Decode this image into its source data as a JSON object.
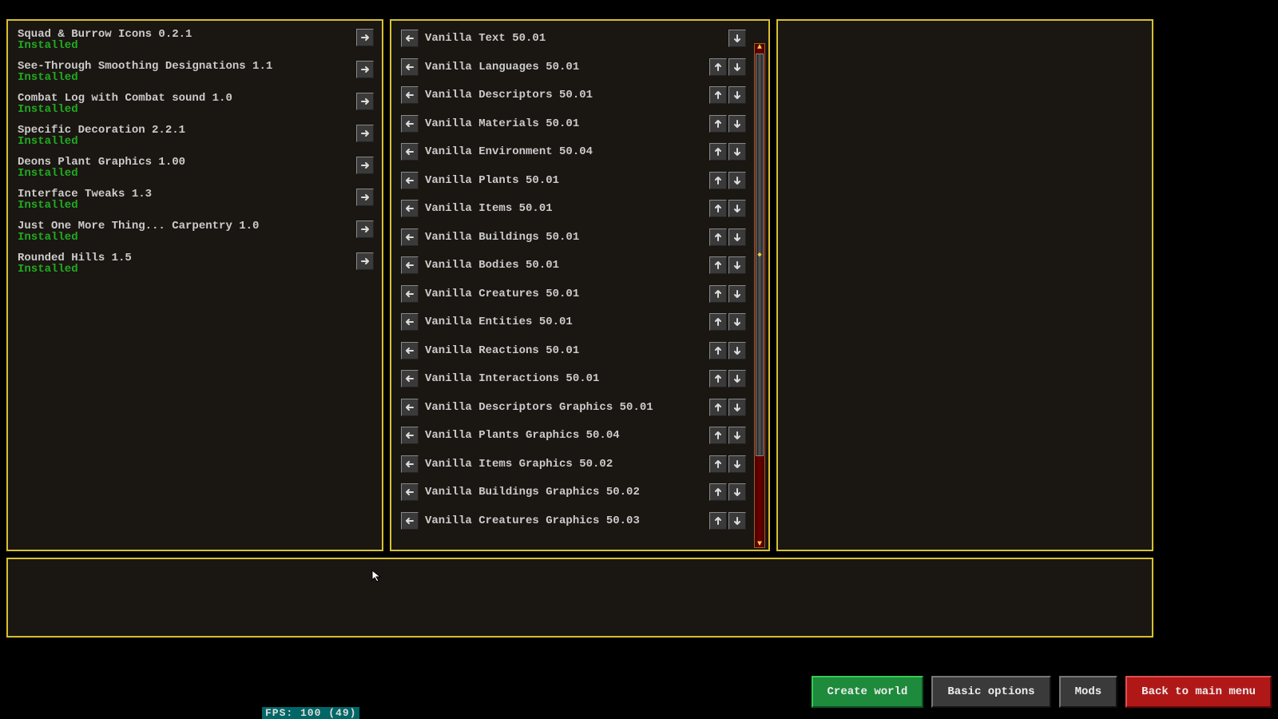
{
  "available": {
    "items": [
      {
        "name": "Squad & Burrow Icons 0.2.1",
        "status": "Installed"
      },
      {
        "name": "See-Through Smoothing Designations 1.1",
        "status": "Installed"
      },
      {
        "name": "Combat Log with Combat sound 1.0",
        "status": "Installed"
      },
      {
        "name": "Specific Decoration 2.2.1",
        "status": "Installed"
      },
      {
        "name": "Deons Plant Graphics 1.00",
        "status": "Installed"
      },
      {
        "name": "Interface Tweaks 1.3",
        "status": "Installed"
      },
      {
        "name": "Just One More Thing... Carpentry 1.0",
        "status": "Installed"
      },
      {
        "name": "Rounded Hills 1.5",
        "status": "Installed"
      }
    ]
  },
  "active": {
    "items": [
      {
        "name": "Vanilla Text 50.01",
        "up": false,
        "down": true
      },
      {
        "name": "Vanilla Languages 50.01",
        "up": true,
        "down": true
      },
      {
        "name": "Vanilla Descriptors 50.01",
        "up": true,
        "down": true
      },
      {
        "name": "Vanilla Materials 50.01",
        "up": true,
        "down": true
      },
      {
        "name": "Vanilla Environment 50.04",
        "up": true,
        "down": true
      },
      {
        "name": "Vanilla Plants 50.01",
        "up": true,
        "down": true
      },
      {
        "name": "Vanilla Items 50.01",
        "up": true,
        "down": true
      },
      {
        "name": "Vanilla Buildings 50.01",
        "up": true,
        "down": true
      },
      {
        "name": "Vanilla Bodies 50.01",
        "up": true,
        "down": true
      },
      {
        "name": "Vanilla Creatures 50.01",
        "up": true,
        "down": true
      },
      {
        "name": "Vanilla Entities 50.01",
        "up": true,
        "down": true
      },
      {
        "name": "Vanilla Reactions 50.01",
        "up": true,
        "down": true
      },
      {
        "name": "Vanilla Interactions 50.01",
        "up": true,
        "down": true
      },
      {
        "name": "Vanilla Descriptors Graphics 50.01",
        "up": true,
        "down": true
      },
      {
        "name": "Vanilla Plants Graphics 50.04",
        "up": true,
        "down": true
      },
      {
        "name": "Vanilla Items Graphics 50.02",
        "up": true,
        "down": true
      },
      {
        "name": "Vanilla Buildings Graphics 50.02",
        "up": true,
        "down": true
      },
      {
        "name": "Vanilla Creatures Graphics 50.03",
        "up": true,
        "down": true
      }
    ]
  },
  "footer": {
    "create_world": "Create world",
    "basic_options": "Basic options",
    "mods": "Mods",
    "back": "Back to main menu"
  },
  "fps": "FPS: 100 (49)"
}
